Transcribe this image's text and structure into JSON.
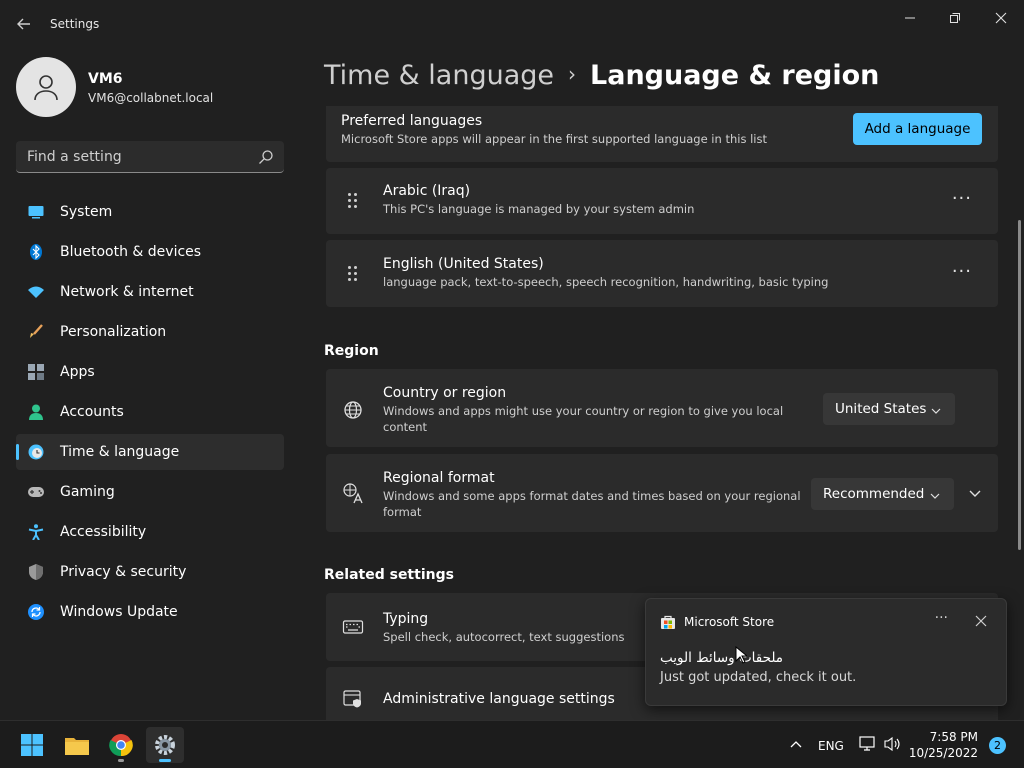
{
  "window": {
    "title": "Settings"
  },
  "profile": {
    "name": "VM6",
    "email": "VM6@collabnet.local"
  },
  "search": {
    "placeholder": "Find a setting"
  },
  "sidebar": {
    "items": [
      {
        "label": "System",
        "icon": "system-icon",
        "color": "#4cc2ff"
      },
      {
        "label": "Bluetooth & devices",
        "icon": "bluetooth-icon",
        "color": "#0078d4"
      },
      {
        "label": "Network & internet",
        "icon": "wifi-icon",
        "color": "#4cc2ff"
      },
      {
        "label": "Personalization",
        "icon": "brush-icon",
        "color": "#e8a25a"
      },
      {
        "label": "Apps",
        "icon": "apps-icon",
        "color": "#9aa7b4"
      },
      {
        "label": "Accounts",
        "icon": "person-icon",
        "color": "#2fc48d"
      },
      {
        "label": "Time & language",
        "icon": "clock-globe-icon",
        "color": "#4cc2ff",
        "active": true
      },
      {
        "label": "Gaming",
        "icon": "controller-icon",
        "color": "#b8b8b8"
      },
      {
        "label": "Accessibility",
        "icon": "accessibility-icon",
        "color": "#4cc2ff"
      },
      {
        "label": "Privacy & security",
        "icon": "shield-icon",
        "color": "#9a9a9a"
      },
      {
        "label": "Windows Update",
        "icon": "update-icon",
        "color": "#1e90ff"
      }
    ]
  },
  "header": {
    "parent": "Time & language",
    "separator": "›",
    "current": "Language & region"
  },
  "preferred": {
    "title": "Preferred languages",
    "subtitle": "Microsoft Store apps will appear in the first supported language in this list",
    "add_button": "Add a language",
    "languages": [
      {
        "name": "Arabic (Iraq)",
        "detail": "This PC's language is managed by your system admin",
        "more": "···"
      },
      {
        "name": "English (United States)",
        "detail": "language pack, text-to-speech, speech recognition, handwriting, basic typing",
        "more": "···"
      }
    ]
  },
  "region": {
    "heading": "Region",
    "country": {
      "title": "Country or region",
      "subtitle_line1": "Windows and apps might use your country or region to give you local",
      "subtitle_line2": "content",
      "value": "United States"
    },
    "format": {
      "title": "Regional format",
      "subtitle_line1": "Windows and some apps format dates and times based on your regional",
      "subtitle_line2": "format",
      "value": "Recommended"
    }
  },
  "related": {
    "heading": "Related settings",
    "typing": {
      "title": "Typing",
      "subtitle": "Spell check, autocorrect, text suggestions"
    },
    "admin": {
      "title": "Administrative language settings"
    }
  },
  "toast": {
    "app": "Microsoft Store",
    "more": "···",
    "title": "ملحقات وسائط الويب",
    "body": "Just got updated, check it out."
  },
  "taskbar": {
    "apps": [
      "start-icon",
      "file-explorer-icon",
      "chrome-icon",
      "settings-icon"
    ],
    "language": "ENG",
    "time": "7:58 PM",
    "date": "10/25/2022",
    "notifications": "2"
  },
  "colors": {
    "accent": "#4cc2ff",
    "background": "#202020",
    "card": "#2b2b2b"
  }
}
